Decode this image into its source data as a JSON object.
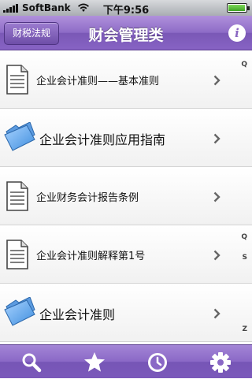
{
  "status_bar": {
    "carrier": "SoftBank",
    "time": "下午9:56"
  },
  "nav": {
    "back_label": "财税法规",
    "title": "财会管理类",
    "info_icon": "info-icon"
  },
  "list": {
    "items": [
      {
        "label": "企业会计准则——基本准则",
        "icon": "document-icon"
      },
      {
        "label": "企业会计准则应用指南",
        "icon": "folder-icon"
      },
      {
        "label": "企业财务会计报告条例",
        "icon": "document-icon"
      },
      {
        "label": "企业会计准则解释第1号",
        "icon": "document-icon"
      },
      {
        "label": "企业会计准则",
        "icon": "folder-icon"
      }
    ]
  },
  "index_bar": {
    "search_glyph": "Q",
    "letters": [
      "Q",
      "S",
      "Z"
    ]
  },
  "tab_bar": {
    "tabs": [
      {
        "icon": "search-icon"
      },
      {
        "icon": "star-icon"
      },
      {
        "icon": "clock-icon"
      },
      {
        "icon": "gear-icon"
      }
    ]
  },
  "colors": {
    "accent": "#8a68c6",
    "accent_dark": "#5b3d8f"
  }
}
